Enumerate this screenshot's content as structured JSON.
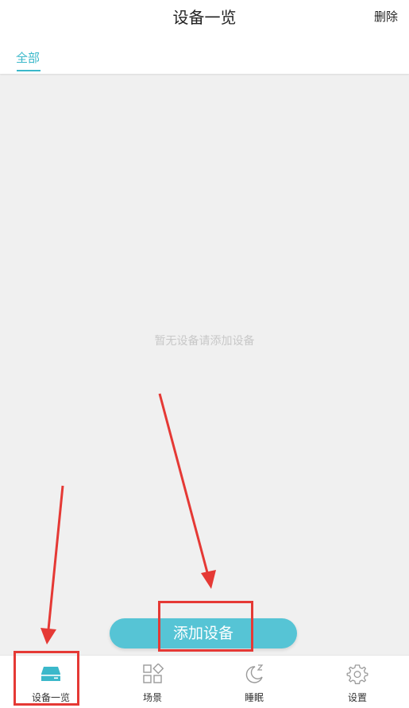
{
  "header": {
    "title": "设备一览",
    "delete_label": "删除"
  },
  "tabs": [
    {
      "label": "全部",
      "active": true
    }
  ],
  "content": {
    "empty_text": "暂无设备请添加设备"
  },
  "actions": {
    "add_device_label": "添加设备"
  },
  "tabbar": {
    "items": [
      {
        "label": "设备一览",
        "icon": "device-list-icon",
        "active": true
      },
      {
        "label": "场景",
        "icon": "scene-icon",
        "active": false
      },
      {
        "label": "睡眠",
        "icon": "sleep-icon",
        "active": false
      },
      {
        "label": "设置",
        "icon": "settings-gear-icon",
        "active": false
      }
    ]
  },
  "colors": {
    "accent": "#3bb8ca",
    "button": "#56c4d5",
    "annotation": "#e53935"
  }
}
